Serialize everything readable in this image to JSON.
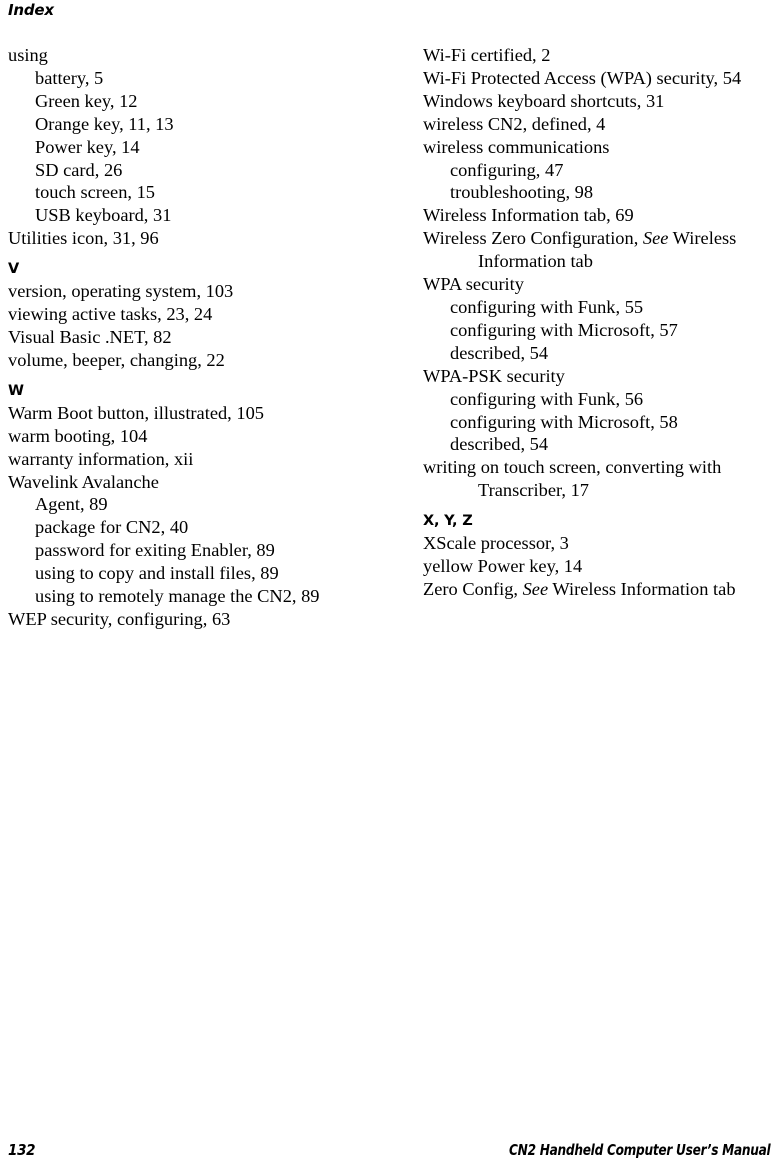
{
  "running_head": "Index",
  "footer": {
    "page_number": "132",
    "manual_title": "CN2 Handheld Computer User’s Manual"
  },
  "columns": {
    "left": [
      {
        "kind": "entry",
        "level": 1,
        "text": "using"
      },
      {
        "kind": "entry",
        "level": 2,
        "text": "battery, 5"
      },
      {
        "kind": "entry",
        "level": 2,
        "text": "Green key, 12"
      },
      {
        "kind": "entry",
        "level": 2,
        "text": "Orange key, 11, 13"
      },
      {
        "kind": "entry",
        "level": 2,
        "text": "Power key, 14"
      },
      {
        "kind": "entry",
        "level": 2,
        "text": "SD card, 26"
      },
      {
        "kind": "entry",
        "level": 2,
        "text": "touch screen, 15"
      },
      {
        "kind": "entry",
        "level": 2,
        "text": "USB keyboard, 31"
      },
      {
        "kind": "entry",
        "level": 1,
        "text": "Utilities icon, 31, 96"
      },
      {
        "kind": "heading",
        "text": "V"
      },
      {
        "kind": "entry",
        "level": 1,
        "text": "version, operating system, 103"
      },
      {
        "kind": "entry",
        "level": 1,
        "text": "viewing active tasks, 23, 24"
      },
      {
        "kind": "entry",
        "level": 1,
        "text": "Visual Basic .NET, 82"
      },
      {
        "kind": "entry",
        "level": 1,
        "text": "volume, beeper, changing, 22"
      },
      {
        "kind": "heading",
        "text": "W"
      },
      {
        "kind": "entry",
        "level": 1,
        "text": "Warm Boot button, illustrated, 105"
      },
      {
        "kind": "entry",
        "level": 1,
        "text": "warm booting, 104"
      },
      {
        "kind": "entry",
        "level": 1,
        "text": "warranty information, xii"
      },
      {
        "kind": "entry",
        "level": 1,
        "text": "Wavelink Avalanche"
      },
      {
        "kind": "entry",
        "level": 2,
        "text": "Agent, 89"
      },
      {
        "kind": "entry",
        "level": 2,
        "text": "package for CN2, 40"
      },
      {
        "kind": "entry",
        "level": 2,
        "text": "password for exiting Enabler, 89"
      },
      {
        "kind": "entry",
        "level": 2,
        "text": "using to copy and install files, 89"
      },
      {
        "kind": "entry",
        "level": 2,
        "text": "using to remotely manage the CN2, 89"
      },
      {
        "kind": "entry",
        "level": 1,
        "text": "WEP security, configuring, 63"
      }
    ],
    "right": [
      {
        "kind": "entry",
        "level": 1,
        "text": "Wi-Fi certified, 2"
      },
      {
        "kind": "entry",
        "level": 1,
        "text": "Wi-Fi Protected Access (WPA) security, 54"
      },
      {
        "kind": "entry",
        "level": 1,
        "text": "Windows keyboard shortcuts, 31"
      },
      {
        "kind": "entry",
        "level": 1,
        "text": "wireless CN2, defined, 4"
      },
      {
        "kind": "entry",
        "level": 1,
        "text": "wireless communications"
      },
      {
        "kind": "entry",
        "level": 2,
        "text": "configuring, 47"
      },
      {
        "kind": "entry",
        "level": 2,
        "text": "troubleshooting, 98"
      },
      {
        "kind": "entry",
        "level": 1,
        "text": "Wireless Information tab, 69"
      },
      {
        "kind": "entry",
        "level": 1,
        "text": "Wireless Zero Configuration, ",
        "italic": "See",
        "text_after": " Wireless Information tab"
      },
      {
        "kind": "entry",
        "level": 1,
        "text": "WPA security"
      },
      {
        "kind": "entry",
        "level": 2,
        "text": "configuring with Funk, 55"
      },
      {
        "kind": "entry",
        "level": 2,
        "text": "configuring with Microsoft, 57"
      },
      {
        "kind": "entry",
        "level": 2,
        "text": "described, 54"
      },
      {
        "kind": "entry",
        "level": 1,
        "text": "WPA-PSK security"
      },
      {
        "kind": "entry",
        "level": 2,
        "text": "configuring with Funk, 56"
      },
      {
        "kind": "entry",
        "level": 2,
        "text": "configuring with Microsoft, 58"
      },
      {
        "kind": "entry",
        "level": 2,
        "text": "described, 54"
      },
      {
        "kind": "entry",
        "level": 1,
        "text": "writing on touch screen, converting with Transcriber, 17"
      },
      {
        "kind": "heading",
        "text": "X, Y, Z"
      },
      {
        "kind": "entry",
        "level": 1,
        "text": "XScale processor, 3"
      },
      {
        "kind": "entry",
        "level": 1,
        "text": "yellow Power key, 14"
      },
      {
        "kind": "entry",
        "level": 1,
        "text": "Zero Config, ",
        "italic": "See",
        "text_after": " Wireless Information tab"
      }
    ]
  }
}
